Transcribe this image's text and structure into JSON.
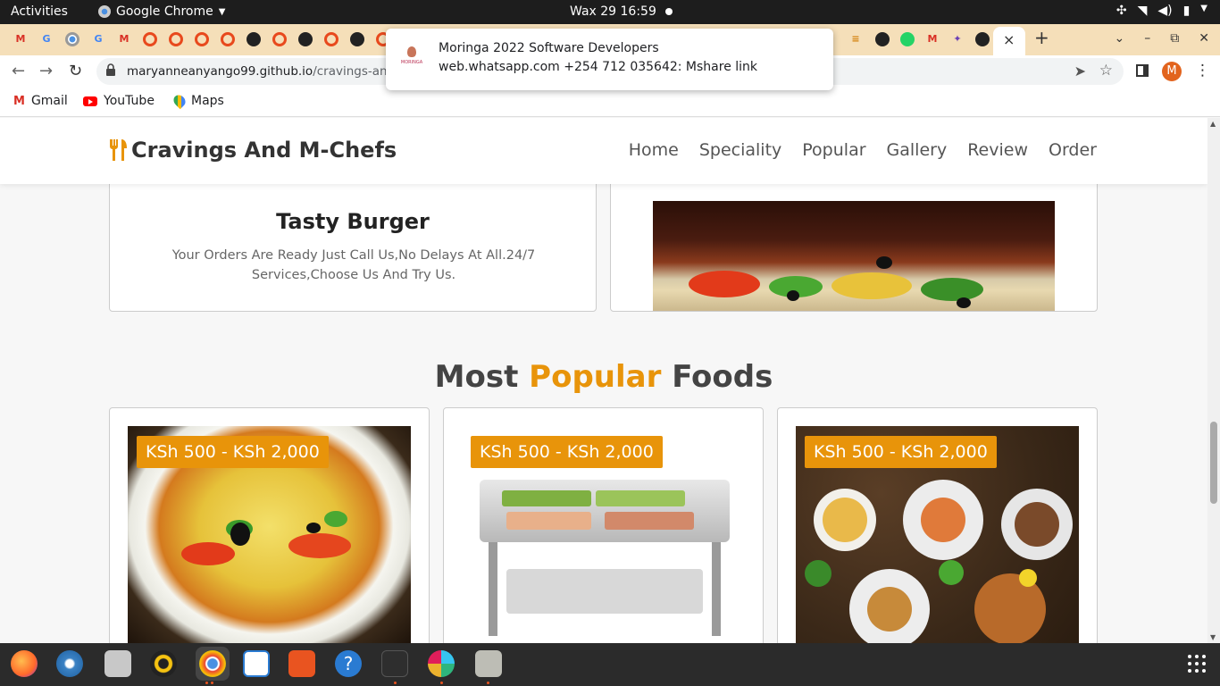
{
  "topbar": {
    "activities": "Activities",
    "app_name": "Google Chrome",
    "clock": "Wax 29  16:59"
  },
  "browser": {
    "url_host": "maryanneanyango99.github.io",
    "url_path": "/cravings-and-M",
    "profile_initial": "M",
    "new_tab": "+",
    "close_tab": "×",
    "bookmarks": [
      {
        "label": "Gmail",
        "icon": "gmail-icon"
      },
      {
        "label": "YouTube",
        "icon": "youtube-icon"
      },
      {
        "label": "Maps",
        "icon": "maps-icon"
      }
    ]
  },
  "notification": {
    "title": "Moringa 2022 Software Developers",
    "body": "web.whatsapp.com  +254 712 035642: Mshare link",
    "logo_text": "MORINGA"
  },
  "site": {
    "brand": "Cravings And M-Chefs",
    "nav": [
      "Home",
      "Speciality",
      "Popular",
      "Gallery",
      "Review",
      "Order"
    ],
    "card_title": "Tasty Burger",
    "card_text": "Your Orders Are Ready Just Call Us,No Delays At All.24/7 Services,Choose Us And Try Us.",
    "section_title_pre": "Most",
    "section_title_accent": "Popular",
    "section_title_post": "Foods",
    "food_cards": [
      {
        "price": "KSh 500 - KSh 2,000"
      },
      {
        "price": "KSh 500 - KSh 2,000"
      },
      {
        "price": "KSh 500 - KSh 2,000"
      }
    ]
  },
  "colors": {
    "accent": "#e8940a",
    "tabstrip": "#f5dfb9",
    "topbar": "#1d1d1d"
  }
}
